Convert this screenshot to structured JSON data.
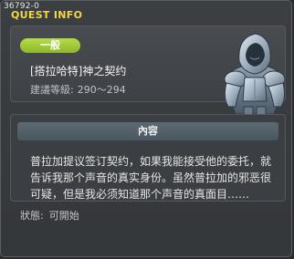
{
  "window": {
    "quest_id": "36792-0",
    "title": "QUEST INFO"
  },
  "quest": {
    "category": "一般",
    "name": "[搭拉哈特]神之契约",
    "level_label": "建議等級:",
    "level_value": "290～294"
  },
  "content": {
    "header": "內容",
    "body": "普拉加提议签订契约，如果我能接受他的委托，就告诉我那个声音的真实身份。虽然普拉加的邪恶很可疑，但是我必须知道那个声音的真面目……"
  },
  "status": {
    "label": "狀態:",
    "value": "可開始"
  },
  "colors": {
    "title": "#f2d64a",
    "badge": "#9cc437",
    "content_header": "#55616b"
  },
  "icons": {
    "npc": "hooded-knight-icon"
  }
}
